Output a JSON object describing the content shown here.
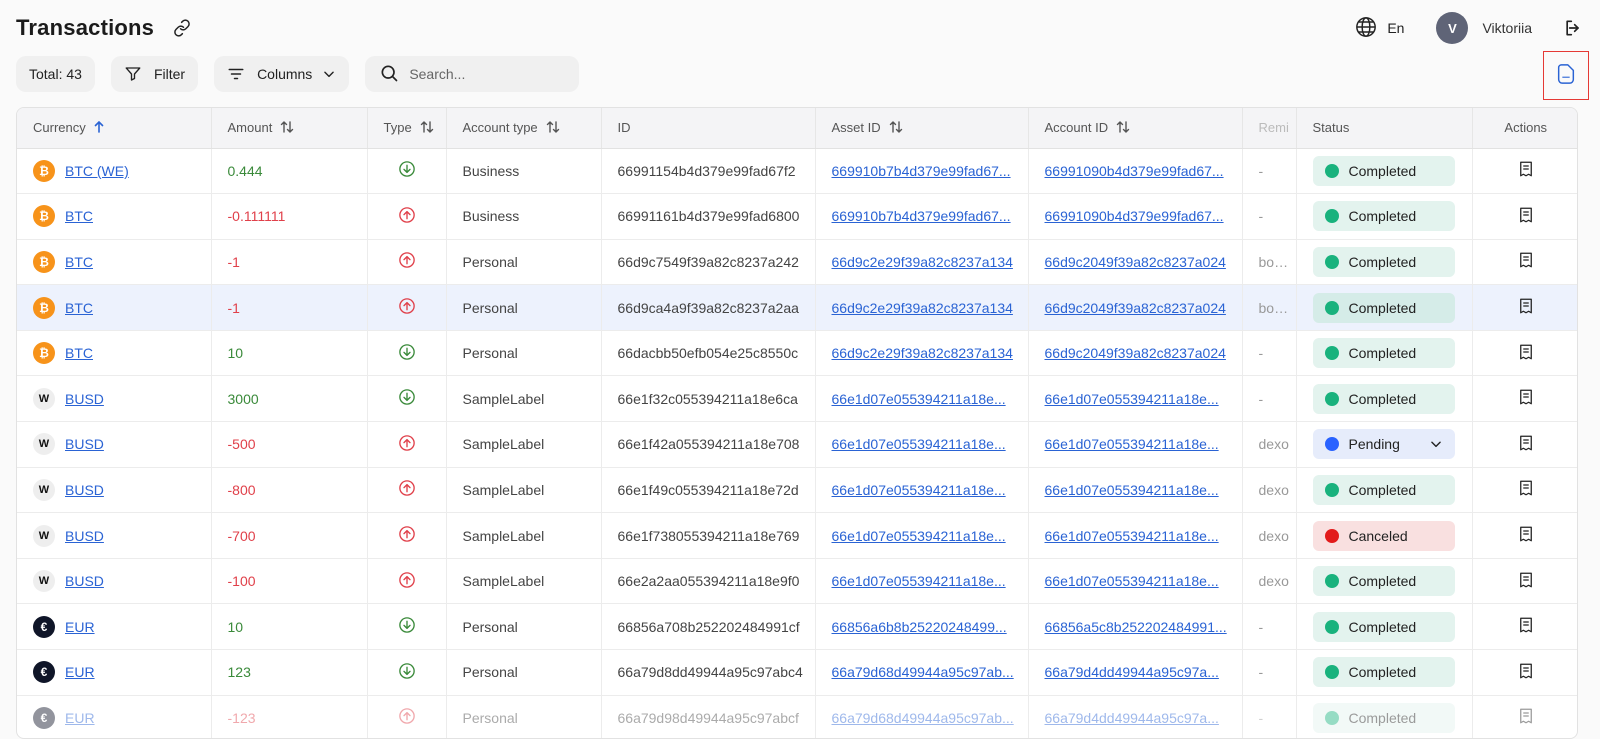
{
  "header": {
    "title": "Transactions",
    "language": "En",
    "user_initial": "V",
    "user_name": "Viktoriia"
  },
  "toolbar": {
    "total_label": "Total: 43",
    "filter_label": "Filter",
    "columns_label": "Columns",
    "search_placeholder": "Search..."
  },
  "columns": [
    "Currency",
    "Amount",
    "Type",
    "Account type",
    "ID",
    "Asset ID",
    "Account ID",
    "Remi",
    "Status",
    "Actions"
  ],
  "colors": {
    "accent": "#2a63d4",
    "positive": "#3a8a3a",
    "negative": "#e0404a",
    "completed": "#19b27d",
    "pending": "#2962ff",
    "canceled": "#e21b1b",
    "btc": "#f7931a"
  },
  "rows": [
    {
      "coin": "btc",
      "coin_glyph": "₿",
      "currency": "BTC (WE)",
      "amount": "0.444",
      "direction": "in",
      "account_type": "Business",
      "id": "66991154b4d379e99fad67f2",
      "asset_id": "669910b7b4d379e99fad67...",
      "account_id": "66991090b4d379e99fad67...",
      "remark": "-",
      "status": "Completed",
      "status_class": "completed"
    },
    {
      "coin": "btc",
      "coin_glyph": "₿",
      "currency": "BTC",
      "amount": "-0.111111",
      "direction": "out",
      "account_type": "Business",
      "id": "66991161b4d379e99fad6800",
      "asset_id": "669910b7b4d379e99fad67...",
      "account_id": "66991090b4d379e99fad67...",
      "remark": "-",
      "status": "Completed",
      "status_class": "completed"
    },
    {
      "coin": "btc",
      "coin_glyph": "₿",
      "currency": "BTC",
      "amount": "-1",
      "direction": "out",
      "account_type": "Personal",
      "id": "66d9c7549f39a82c8237a242",
      "asset_id": "66d9c2e29f39a82c8237a134",
      "account_id": "66d9c2049f39a82c8237a024",
      "remark": "bob@",
      "status": "Completed",
      "status_class": "completed"
    },
    {
      "coin": "btc",
      "coin_glyph": "₿",
      "currency": "BTC",
      "amount": "-1",
      "direction": "out",
      "account_type": "Personal",
      "id": "66d9ca4a9f39a82c8237a2aa",
      "asset_id": "66d9c2e29f39a82c8237a134",
      "account_id": "66d9c2049f39a82c8237a024",
      "remark": "bob@",
      "status": "Completed",
      "status_class": "completed",
      "selected": true
    },
    {
      "coin": "btc",
      "coin_glyph": "₿",
      "currency": "BTC",
      "amount": "10",
      "direction": "in",
      "account_type": "Personal",
      "id": "66dacbb50efb054e25c8550c",
      "asset_id": "66d9c2e29f39a82c8237a134",
      "account_id": "66d9c2049f39a82c8237a024",
      "remark": "-",
      "status": "Completed",
      "status_class": "completed"
    },
    {
      "coin": "busd",
      "coin_glyph": "W",
      "currency": "BUSD",
      "amount": "3000",
      "direction": "in",
      "account_type": "SampleLabel",
      "id": "66e1f32c055394211a18e6ca",
      "asset_id": "66e1d07e055394211a18e...",
      "account_id": "66e1d07e055394211a18e...",
      "remark": "-",
      "status": "Completed",
      "status_class": "completed"
    },
    {
      "coin": "busd",
      "coin_glyph": "W",
      "currency": "BUSD",
      "amount": "-500",
      "direction": "out",
      "account_type": "SampleLabel",
      "id": "66e1f42a055394211a18e708",
      "asset_id": "66e1d07e055394211a18e...",
      "account_id": "66e1d07e055394211a18e...",
      "remark": "dexo",
      "status": "Pending",
      "status_class": "pending"
    },
    {
      "coin": "busd",
      "coin_glyph": "W",
      "currency": "BUSD",
      "amount": "-800",
      "direction": "out",
      "account_type": "SampleLabel",
      "id": "66e1f49c055394211a18e72d",
      "asset_id": "66e1d07e055394211a18e...",
      "account_id": "66e1d07e055394211a18e...",
      "remark": "dexo",
      "status": "Completed",
      "status_class": "completed"
    },
    {
      "coin": "busd",
      "coin_glyph": "W",
      "currency": "BUSD",
      "amount": "-700",
      "direction": "out",
      "account_type": "SampleLabel",
      "id": "66e1f738055394211a18e769",
      "asset_id": "66e1d07e055394211a18e...",
      "account_id": "66e1d07e055394211a18e...",
      "remark": "dexo",
      "status": "Canceled",
      "status_class": "canceled"
    },
    {
      "coin": "busd",
      "coin_glyph": "W",
      "currency": "BUSD",
      "amount": "-100",
      "direction": "out",
      "account_type": "SampleLabel",
      "id": "66e2a2aa055394211a18e9f0",
      "asset_id": "66e1d07e055394211a18e...",
      "account_id": "66e1d07e055394211a18e...",
      "remark": "dexo",
      "status": "Completed",
      "status_class": "completed"
    },
    {
      "coin": "eur",
      "coin_glyph": "€",
      "currency": "EUR",
      "amount": "10",
      "direction": "in",
      "account_type": "Personal",
      "id": "66856a708b252202484991cf",
      "asset_id": "66856a6b8b25220248499...",
      "account_id": "66856a5c8b252202484991...",
      "remark": "-",
      "status": "Completed",
      "status_class": "completed"
    },
    {
      "coin": "eur",
      "coin_glyph": "€",
      "currency": "EUR",
      "amount": "123",
      "direction": "in",
      "account_type": "Personal",
      "id": "66a79d8dd49944a95c97abc4",
      "asset_id": "66a79d68d49944a95c97ab...",
      "account_id": "66a79d4dd49944a95c97a...",
      "remark": "-",
      "status": "Completed",
      "status_class": "completed"
    },
    {
      "coin": "eur",
      "coin_glyph": "€",
      "currency": "EUR",
      "amount": "-123",
      "direction": "out",
      "account_type": "Personal",
      "id": "66a79d98d49944a95c97abcf",
      "asset_id": "66a79d68d49944a95c97ab...",
      "account_id": "66a79d4dd49944a95c97a...",
      "remark": "-",
      "status": "Completed",
      "status_class": "completed",
      "faded": true
    }
  ]
}
